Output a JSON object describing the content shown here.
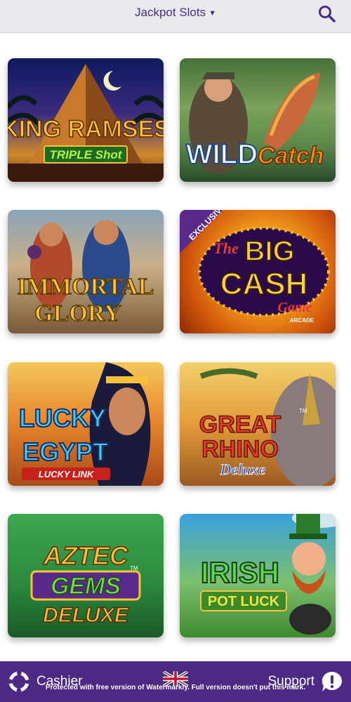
{
  "header": {
    "title": "Jackpot Slots",
    "dropdown_icon": "chevron-down-icon",
    "search_icon": "search-icon"
  },
  "games": [
    {
      "title_line1": "KING RAMSES",
      "title_line2": "TRIPLE Shot"
    },
    {
      "title_line1": "WILD",
      "title_line2": "Catch"
    },
    {
      "title_line1": "IMMORTAL",
      "title_line2": "GLORY"
    },
    {
      "badge": "EXCLUSIVE",
      "title_line1": "The",
      "title_line2": "BIG",
      "title_line3": "CASH",
      "title_line4": "Game",
      "title_line5": "ARCADE"
    },
    {
      "title_line1": "LUCKY",
      "title_line2": "EGYPT",
      "title_line3": "LUCKY LINK"
    },
    {
      "title_line1": "GREAT",
      "title_line2": "RHINO",
      "title_line3": "Deluxe",
      "mark": "TM"
    },
    {
      "title_line1": "AZTEC",
      "title_line2": "GEMS",
      "title_line3": "DELUXE",
      "mark": "TM"
    },
    {
      "title_line1": "IRISH",
      "title_line2": "POT LUCK"
    }
  ],
  "bottom_nav": {
    "cashier_label": "Cashier",
    "support_label": "Support",
    "cashier_icon": "lifebuoy-icon",
    "support_icon": "alert-icon",
    "language_icon": "uk-flag-icon"
  },
  "watermark": "Protected with free version of Watermarkly. Full version doesn't put this mark.",
  "colors": {
    "accent": "#4b2985",
    "header_bg": "#e9e9ee",
    "title": "#4a2c86"
  }
}
